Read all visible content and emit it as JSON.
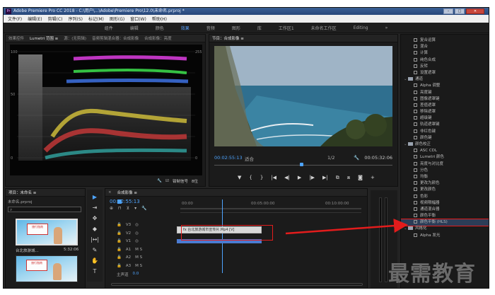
{
  "window": {
    "title": "Adobe Premiere Pro CC 2018 - C:\\用户\\...\\Adobe\\Premiere Pro\\12.0\\未命名.prproj *",
    "app_icon": "Pr"
  },
  "menu": [
    "文件(F)",
    "编辑(E)",
    "剪辑(C)",
    "序列(S)",
    "标记(M)",
    "图形(G)",
    "窗口(W)",
    "帮助(H)"
  ],
  "workspaces": {
    "items": [
      "组件",
      "编辑",
      "颜色",
      "效果",
      "音频",
      "图形",
      "库",
      "工作区1",
      "未命名工作区",
      "Editing"
    ],
    "active": "效果",
    "more": "»"
  },
  "scopes_panel": {
    "tabs": [
      "效果控件",
      "Lumetri 范围 ≡",
      "源：(无剪辑)",
      "音频剪辑混合器：合成影像",
      "合成影像：亮度"
    ],
    "bottom_label": "8位",
    "clamp_label": "钳制信号"
  },
  "program_monitor": {
    "tab": "节目：合成影像 ≡",
    "timecode_left": "00:02:55:13",
    "fit": "适合",
    "resolution": "1/2",
    "timecode_right": "00:05:32:06",
    "transport": [
      "▼",
      "{",
      "}",
      "|◀",
      "◀|",
      "▶",
      "|▶",
      "▶|",
      "⧉",
      "⧈",
      "◙",
      "+"
    ]
  },
  "effects_panel": {
    "items": [
      {
        "label": "复合运算",
        "kind": "item"
      },
      {
        "label": "混合",
        "kind": "item"
      },
      {
        "label": "计算",
        "kind": "item"
      },
      {
        "label": "纯色合成",
        "kind": "item"
      },
      {
        "label": "反转",
        "kind": "item"
      },
      {
        "label": "设置遮罩",
        "kind": "item"
      },
      {
        "label": "通道",
        "kind": "folder"
      },
      {
        "label": "Alpha 调整",
        "kind": "item"
      },
      {
        "label": "亮度键",
        "kind": "item"
      },
      {
        "label": "图像遮罩键",
        "kind": "item"
      },
      {
        "label": "差值遮罩",
        "kind": "item"
      },
      {
        "label": "移除遮罩",
        "kind": "item"
      },
      {
        "label": "超级键",
        "kind": "item"
      },
      {
        "label": "轨道遮罩键",
        "kind": "item"
      },
      {
        "label": "非红色键",
        "kind": "item"
      },
      {
        "label": "颜色键",
        "kind": "item"
      },
      {
        "label": "颜色校正",
        "kind": "folder"
      },
      {
        "label": "ASC CDL",
        "kind": "item"
      },
      {
        "label": "Lumetri 颜色",
        "kind": "item"
      },
      {
        "label": "亮度与对比度",
        "kind": "item"
      },
      {
        "label": "分色",
        "kind": "item"
      },
      {
        "label": "均衡",
        "kind": "item"
      },
      {
        "label": "更改为颜色",
        "kind": "item"
      },
      {
        "label": "更改颜色",
        "kind": "item"
      },
      {
        "label": "色彩",
        "kind": "item"
      },
      {
        "label": "视频限幅器",
        "kind": "item"
      },
      {
        "label": "通道混合器",
        "kind": "item"
      },
      {
        "label": "颜色平衡",
        "kind": "item"
      },
      {
        "label": "颜色平衡 (HLS)",
        "kind": "item-highlight"
      },
      {
        "label": "风格化",
        "kind": "folder"
      },
      {
        "label": "Alpha 发光",
        "kind": "item"
      }
    ]
  },
  "project_panel": {
    "tab": "项目：未命名 ≡",
    "sub": "未命名.prproj",
    "clips": [
      {
        "label": "台北旅游城...",
        "duration": "5:32:06",
        "sign": "旅行指南"
      },
      {
        "label": "",
        "duration": "",
        "sign": "旅行指南"
      }
    ]
  },
  "tools": [
    "▶",
    "⇥",
    "✥",
    "◆",
    "|↔|",
    "✎",
    "✋",
    "T"
  ],
  "timeline": {
    "tab": "合成影像 ≡",
    "timecode": "00:02:55:13",
    "ruler": [
      "00:00",
      "00:05:00:00",
      "00:10:00:00"
    ],
    "controls": [
      "⊕",
      "⊓",
      "⊻",
      "▾",
      "🔧"
    ],
    "tracks": [
      {
        "name": "V3",
        "eye": "◎"
      },
      {
        "name": "V2",
        "eye": "◎"
      },
      {
        "name": "V1",
        "eye": "◎"
      },
      {
        "name": "A1",
        "eye": "M S"
      },
      {
        "name": "A2",
        "eye": "M S"
      },
      {
        "name": "A3",
        "eye": "M S"
      }
    ],
    "master": "主声道",
    "master_value": "0.0",
    "clip_label": "fx 台北旅游城市宣传片.Mp4 [V]"
  },
  "watermark": "最需教育",
  "colors": {
    "accent": "#4ea4ff",
    "highlight_red": "#e31c1c",
    "panel_bg": "#1b1b1b"
  }
}
